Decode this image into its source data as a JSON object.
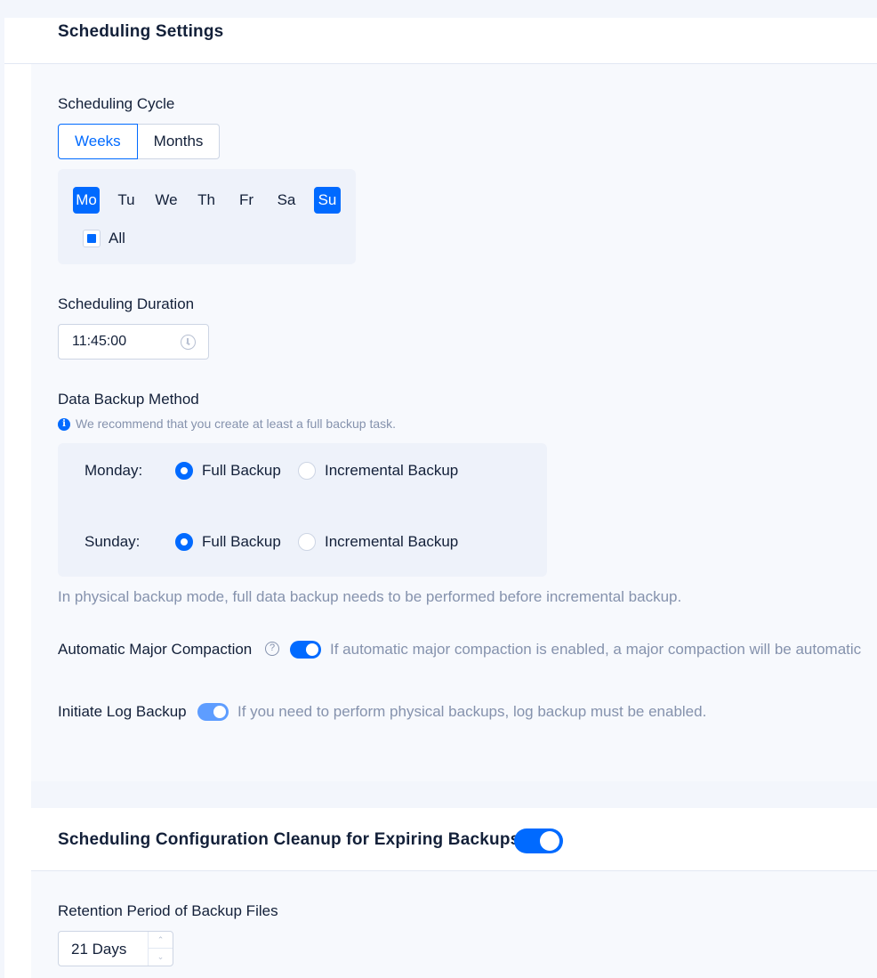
{
  "scheduling_settings": {
    "title": "Scheduling Settings",
    "cycle": {
      "label": "Scheduling Cycle",
      "options": [
        "Weeks",
        "Months"
      ],
      "selected": "Weeks"
    },
    "days": [
      {
        "label": "Mo",
        "selected": true
      },
      {
        "label": "Tu",
        "selected": false
      },
      {
        "label": "We",
        "selected": false
      },
      {
        "label": "Th",
        "selected": false
      },
      {
        "label": "Fr",
        "selected": false
      },
      {
        "label": "Sa",
        "selected": false
      },
      {
        "label": "Su",
        "selected": true
      }
    ],
    "all_label": "All",
    "all_state": "indeterminate",
    "duration": {
      "label": "Scheduling Duration",
      "value": "11:45:00"
    },
    "backup_method": {
      "label": "Data Backup Method",
      "hint": "We recommend that you create at least a full backup task.",
      "rows": [
        {
          "day": "Monday:",
          "options": [
            "Full Backup",
            "Incremental Backup"
          ],
          "selected": "Full Backup"
        },
        {
          "day": "Sunday:",
          "options": [
            "Full Backup",
            "Incremental Backup"
          ],
          "selected": "Full Backup"
        }
      ],
      "note": "In physical backup mode, full data backup needs to be performed before incremental backup."
    },
    "major_compaction": {
      "label": "Automatic Major Compaction",
      "enabled": true,
      "description": "If automatic major compaction is enabled, a major compaction will be automatic"
    },
    "log_backup": {
      "label": "Initiate Log Backup",
      "enabled": true,
      "description": "If you need to perform physical backups, log backup must be enabled."
    }
  },
  "cleanup": {
    "title": "Scheduling Configuration Cleanup for Expiring Backups",
    "enabled": true,
    "retention": {
      "label": "Retention Period of Backup Files",
      "value": "21 Days"
    }
  },
  "colors": {
    "primary": "#006aff",
    "text": "#132039",
    "muted": "#8592ad"
  }
}
